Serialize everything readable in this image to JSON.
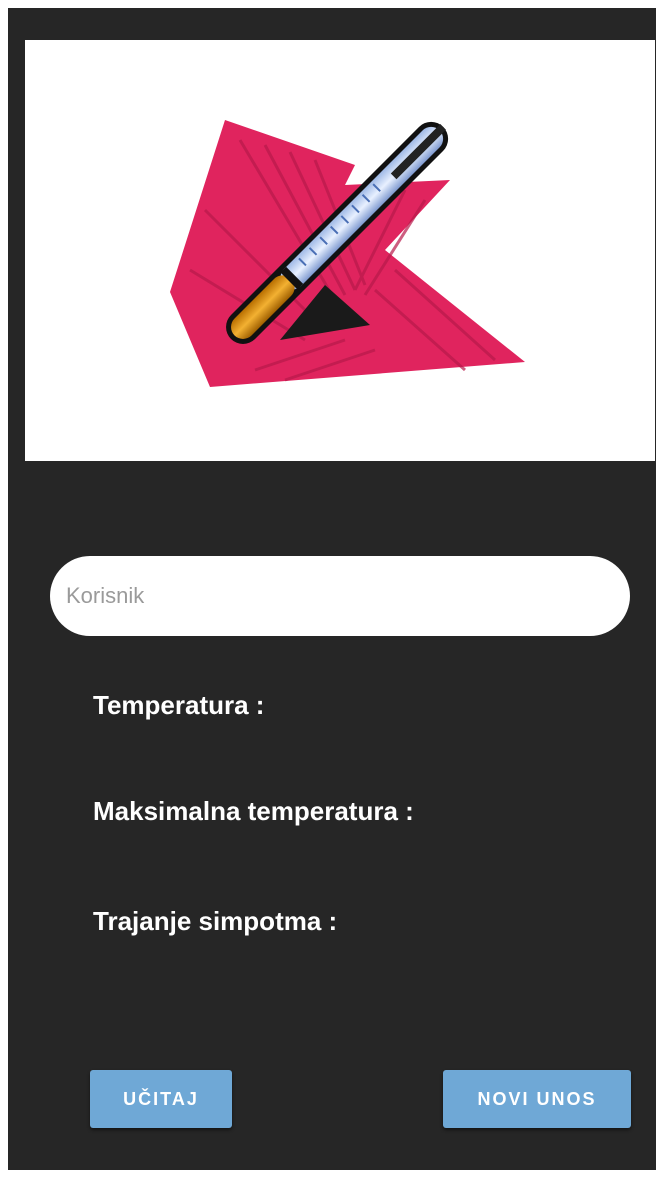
{
  "form": {
    "user_placeholder": "Korisnik",
    "user_value": ""
  },
  "labels": {
    "temperature": "Temperatura :",
    "max_temperature": "Maksimalna temperatura :",
    "symptom_duration": "Trajanje simpotma :"
  },
  "buttons": {
    "load": "UČITAJ",
    "new_entry": "NOVI UNOS"
  },
  "header_image": {
    "icon": "thermometer-icon"
  },
  "colors": {
    "background": "#262626",
    "button": "#6fa8d6",
    "accent": "#e0245e"
  }
}
